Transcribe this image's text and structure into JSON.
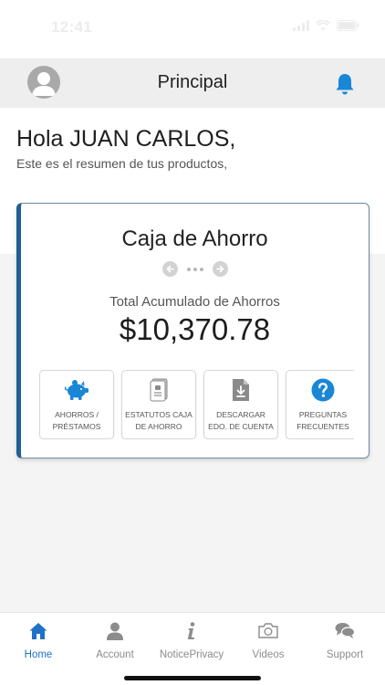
{
  "status_bar": {
    "time": "12:41"
  },
  "header": {
    "title": "Principal"
  },
  "greeting": {
    "title": "Hola JUAN CARLOS,",
    "subtitle": "Este es el resumen de tus productos,"
  },
  "account_card": {
    "title": "Caja de Ahorro",
    "total_label": "Total Acumulado de Ahorros",
    "total_value": "$10,370.78",
    "actions": [
      {
        "label": "Ahorros / Préstamos",
        "icon": "piggy-bank-icon"
      },
      {
        "label": "Estatutos Caja de Ahorro",
        "icon": "document-icon"
      },
      {
        "label": "Descargar Edo. de Cuenta",
        "icon": "download-file-icon"
      },
      {
        "label": "Preguntas Frecuentes",
        "icon": "question-icon"
      }
    ]
  },
  "bottom_nav": [
    {
      "label": "Home",
      "icon": "home-icon",
      "active": true
    },
    {
      "label": "Account",
      "icon": "user-icon",
      "active": false
    },
    {
      "label": "NoticePrivacy",
      "icon": "info-icon",
      "active": false
    },
    {
      "label": "Videos",
      "icon": "camera-icon",
      "active": false
    },
    {
      "label": "Support",
      "icon": "chat-icon",
      "active": false
    }
  ],
  "colors": {
    "accent": "#1f72c8",
    "card_border": "#1f5f94",
    "icon_blue": "#1a86d6",
    "inactive": "#8c8c8c"
  }
}
